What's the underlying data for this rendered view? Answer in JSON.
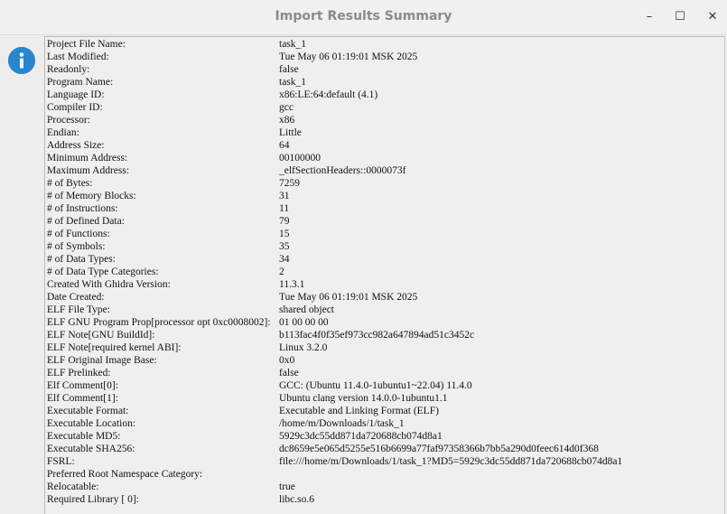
{
  "window": {
    "title": "Import Results Summary",
    "controls": {
      "minimize": "–",
      "maximize": "☐",
      "close": "✕"
    }
  },
  "icon": "info-icon",
  "colors": {
    "info_blue": "#2a86cc",
    "pink_accent": "#f5b8bf"
  },
  "rows": [
    {
      "k": "Project File Name:",
      "v": "task_1"
    },
    {
      "k": "Last Modified:",
      "v": "Tue May 06 01:19:01 MSK 2025"
    },
    {
      "k": "Readonly:",
      "v": "false"
    },
    {
      "k": "Program Name:",
      "v": "task_1"
    },
    {
      "k": "Language ID:",
      "v": "x86:LE:64:default (4.1)"
    },
    {
      "k": "Compiler ID:",
      "v": "gcc"
    },
    {
      "k": "Processor:",
      "v": "x86"
    },
    {
      "k": "Endian:",
      "v": "Little"
    },
    {
      "k": "Address Size:",
      "v": "64"
    },
    {
      "k": "Minimum Address:",
      "v": "00100000"
    },
    {
      "k": "Maximum Address:",
      "v": "_elfSectionHeaders::0000073f"
    },
    {
      "k": "# of Bytes:",
      "v": "7259"
    },
    {
      "k": "# of Memory Blocks:",
      "v": "31"
    },
    {
      "k": "# of Instructions:",
      "v": "11"
    },
    {
      "k": "# of Defined Data:",
      "v": "79"
    },
    {
      "k": "# of Functions:",
      "v": "15"
    },
    {
      "k": "# of Symbols:",
      "v": "35"
    },
    {
      "k": "# of Data Types:",
      "v": "34"
    },
    {
      "k": "# of Data Type Categories:",
      "v": "2"
    },
    {
      "k": "Created With Ghidra Version:",
      "v": "11.3.1"
    },
    {
      "k": "Date Created:",
      "v": "Tue May 06 01:19:01 MSK 2025"
    },
    {
      "k": "ELF File Type:",
      "v": "shared object"
    },
    {
      "k": "ELF GNU Program Prop[processor opt 0xc0008002]:",
      "v": "01 00 00 00"
    },
    {
      "k": "ELF Note[GNU BuildId]:",
      "v": "b113fac4f0f35ef973cc982a647894ad51c3452c"
    },
    {
      "k": "ELF Note[required kernel ABI]:",
      "v": "Linux 3.2.0"
    },
    {
      "k": "ELF Original Image Base:",
      "v": "0x0"
    },
    {
      "k": "ELF Prelinked:",
      "v": "false"
    },
    {
      "k": "Elf Comment[0]:",
      "v": "GCC: (Ubuntu 11.4.0-1ubuntu1~22.04) 11.4.0"
    },
    {
      "k": "Elf Comment[1]:",
      "v": "Ubuntu clang version 14.0.0-1ubuntu1.1"
    },
    {
      "k": "Executable Format:",
      "v": "Executable and Linking Format (ELF)"
    },
    {
      "k": "Executable Location:",
      "v": "/home/m/Downloads/1/task_1"
    },
    {
      "k": "Executable MD5:",
      "v": "5929c3dc55dd871da720688cb074d8a1"
    },
    {
      "k": "Executable SHA256:",
      "v": "dc8659e5e065d5255e516b6699a77faf97358366b7bb5a290d0feec614d0f368"
    },
    {
      "k": "FSRL:",
      "v": "file:///home/m/Downloads/1/task_1?MD5=5929c3dc55dd871da720688cb074d8a1"
    },
    {
      "k": "Preferred Root Namespace Category:",
      "v": ""
    },
    {
      "k": "Relocatable:",
      "v": "true"
    },
    {
      "k": "Required Library [    0]:",
      "v": "libc.so.6"
    }
  ]
}
